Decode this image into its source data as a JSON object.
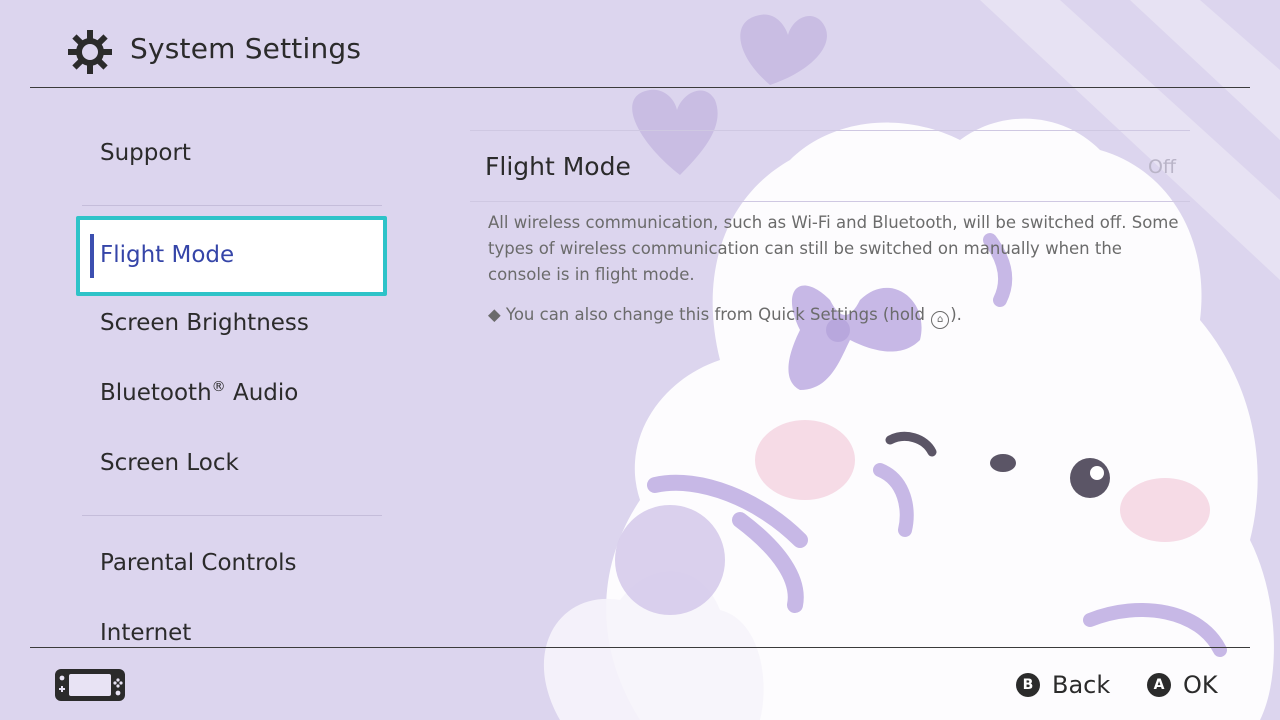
{
  "header": {
    "title": "System Settings",
    "icon": "gear-icon"
  },
  "sidebar": {
    "items": [
      {
        "label": "Support"
      },
      {
        "label": "Flight Mode"
      },
      {
        "label": "Screen Brightness"
      },
      {
        "label": "Bluetooth",
        "label_suffix": "®",
        "label_rest": " Audio"
      },
      {
        "label": "Screen Lock"
      },
      {
        "label": "Parental Controls"
      },
      {
        "label": "Internet"
      }
    ],
    "selected": "Flight Mode"
  },
  "panel": {
    "title": "Flight Mode",
    "state": "Off",
    "description": "All wireless communication, such as Wi-Fi and Bluetooth, will be switched off. Some types of wireless communication can still be switched on manually when the console is in flight mode.",
    "note_prefix": "◆ You can also change this from Quick Settings (hold ",
    "note_suffix": ")."
  },
  "footer": {
    "console_icon": "handheld-console-icon",
    "back": {
      "glyph": "B",
      "label": "Back"
    },
    "ok": {
      "glyph": "A",
      "label": "OK"
    }
  },
  "colors": {
    "background": "#d9d2ec",
    "selection_border": "#2ec3c8",
    "selection_text": "#3545a8",
    "selection_bar": "#3c4fb0"
  }
}
